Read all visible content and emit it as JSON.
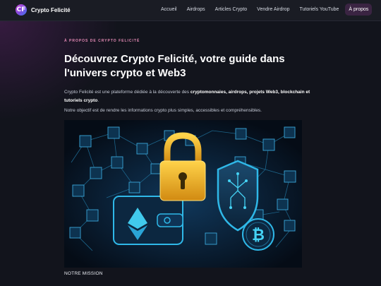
{
  "brand": {
    "logo_letter": "CF",
    "name": "Crypto Felicité"
  },
  "nav": {
    "items": [
      {
        "label": "Accueil"
      },
      {
        "label": "Airdrops"
      },
      {
        "label": "Articles Crypto"
      },
      {
        "label": "Vendre Airdrop"
      },
      {
        "label": "Tutoriels YouTube"
      },
      {
        "label": "À propos",
        "active": true
      }
    ]
  },
  "hero": {
    "eyebrow": "À PROPOS DE CRYPTO FELICITÉ",
    "title": "Découvrez Crypto Felicité, votre guide dans l'univers crypto et Web3",
    "intro": {
      "prefix": "Crypto Felicité est une plateforme dédiée à la découverte des ",
      "bold": "cryptomonnaies, airdrops, projets Web3, blockchain et tutoriels crypto",
      "suffix": "."
    },
    "intro2": "Notre objectif est de rendre les informations crypto plus simples, accessibles et compréhensibles.",
    "illustration": {
      "icons": [
        "padlock-icon",
        "shield-icon",
        "wallet-icon",
        "ethereum-icon",
        "bitcoin-icon",
        "cube-icon"
      ],
      "bitcoin_symbol": "₿"
    }
  },
  "section": {
    "mission_label": "NOTRE MISSION"
  },
  "colors": {
    "accent": "#e58bb6",
    "nav_active_bg": "#3a2442",
    "neon_cyan": "#2fb8e8",
    "gold": "#f0b020"
  }
}
